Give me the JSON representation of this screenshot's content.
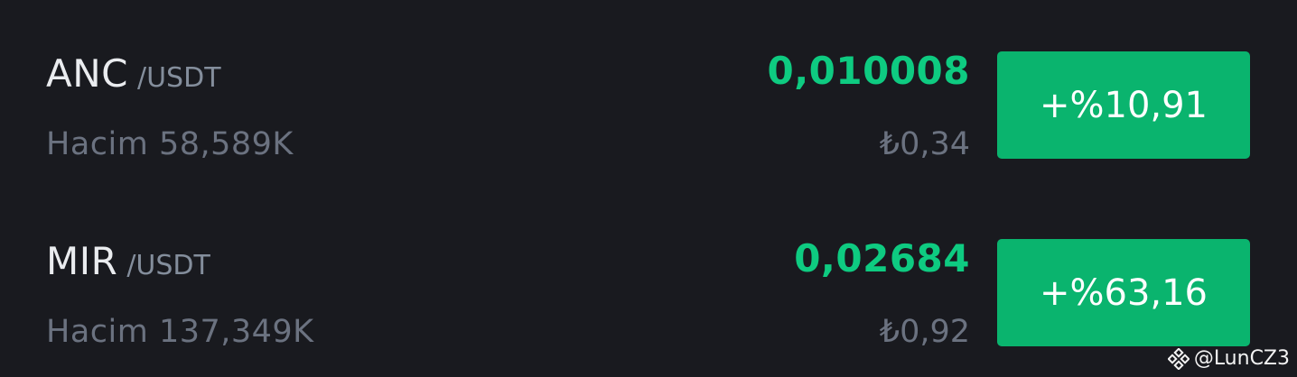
{
  "rows": [
    {
      "base": "ANC",
      "quote": "/USDT",
      "volume": "Hacim 58,589K",
      "price": "0,010008",
      "price_try": "₺0,34",
      "change": "+%10,91"
    },
    {
      "base": "MIR",
      "quote": "/USDT",
      "volume": "Hacim 137,349K",
      "price": "0,02684",
      "price_try": "₺0,92",
      "change": "+%63,16"
    }
  ],
  "watermark": {
    "text": "@LunCZ3",
    "icon": "binance-logo-icon"
  },
  "colors": {
    "background": "#191a1f",
    "up": "#0ecb81",
    "button_up": "#0ab46e",
    "muted": "#6b7280",
    "text": "#eaecef"
  }
}
